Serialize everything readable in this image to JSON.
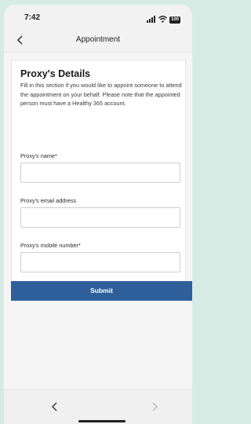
{
  "status": {
    "time": "7:42",
    "battery": "100"
  },
  "nav": {
    "title": "Appointment"
  },
  "proxy": {
    "title": "Proxy's Details",
    "description": "Fill in this section if you would like to appoint someone to attend the appointment on your behalf. Please note that the appointed person must have a Healthy 365 account.",
    "fields": [
      {
        "label": "Proxy's name*",
        "value": ""
      },
      {
        "label": "Proxy's email address",
        "value": ""
      },
      {
        "label": "Proxy's mobile number*",
        "value": ""
      }
    ]
  },
  "actions": {
    "submit_label": "Submit"
  },
  "colors": {
    "accent": "#2e5f9a",
    "background": "#d6ebe4"
  },
  "icons": {
    "back": "chevron-left-icon",
    "prev": "chevron-left-icon",
    "next": "chevron-right-icon",
    "signal": "signal-icon",
    "wifi": "wifi-icon",
    "battery": "battery-icon"
  }
}
